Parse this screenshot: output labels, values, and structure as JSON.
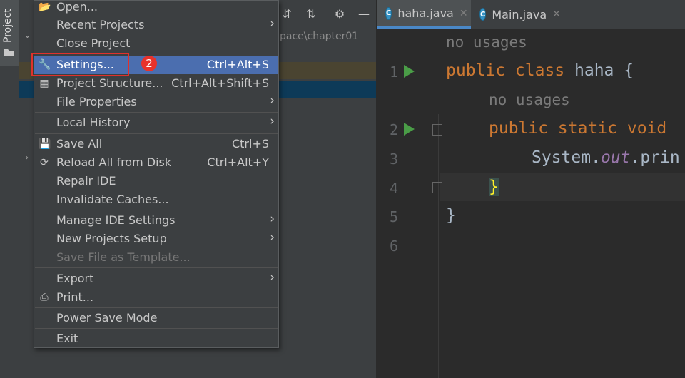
{
  "toolwindow": {
    "tab_label": "Project"
  },
  "project_panel": {
    "path_text": "pace\\chapter01"
  },
  "editor": {
    "tabs": [
      {
        "label": "haha.java",
        "icon": "java-class-icon",
        "active": true
      },
      {
        "label": "Main.java",
        "icon": "java-class-icon",
        "active": false
      }
    ],
    "line_numbers": [
      "1",
      "2",
      "3",
      "4",
      "5",
      "6"
    ],
    "hint_no_usages": "no usages",
    "code": {
      "line1_kw": "public class ",
      "line1_name": "haha {",
      "line2_kw": "public static void",
      "line3_a": "System.",
      "line3_b": "out",
      "line3_c": ".prin",
      "line4": "}",
      "line5": "}"
    }
  },
  "menu": {
    "items": [
      {
        "label": "Open...",
        "icon": "folder-open-icon"
      },
      {
        "label": "Recent Projects",
        "submenu": true
      },
      {
        "label": "Close Project"
      },
      {
        "label": "Settings...",
        "shortcut": "Ctrl+Alt+S",
        "icon": "wrench-icon",
        "selected": true
      },
      {
        "label": "Project Structure...",
        "shortcut": "Ctrl+Alt+Shift+S",
        "icon": "project-structure-icon"
      },
      {
        "label": "File Properties",
        "submenu": true
      },
      {
        "label": "Local History",
        "submenu": true
      },
      {
        "label": "Save All",
        "shortcut": "Ctrl+S",
        "icon": "save-icon"
      },
      {
        "label": "Reload All from Disk",
        "shortcut": "Ctrl+Alt+Y",
        "icon": "reload-icon"
      },
      {
        "label": "Repair IDE"
      },
      {
        "label": "Invalidate Caches..."
      },
      {
        "label": "Manage IDE Settings",
        "submenu": true
      },
      {
        "label": "New Projects Setup",
        "submenu": true
      },
      {
        "label": "Save File as Template...",
        "disabled": true
      },
      {
        "label": "Export",
        "submenu": true
      },
      {
        "label": "Print...",
        "icon": "print-icon"
      },
      {
        "label": "Power Save Mode"
      },
      {
        "label": "Exit"
      }
    ]
  },
  "annotation": {
    "step_badge": "2"
  },
  "colors": {
    "selection": "#4b6eaf",
    "annotation_red": "#e0312c",
    "keyword": "#cc7832",
    "run_green": "#4a9d47"
  }
}
